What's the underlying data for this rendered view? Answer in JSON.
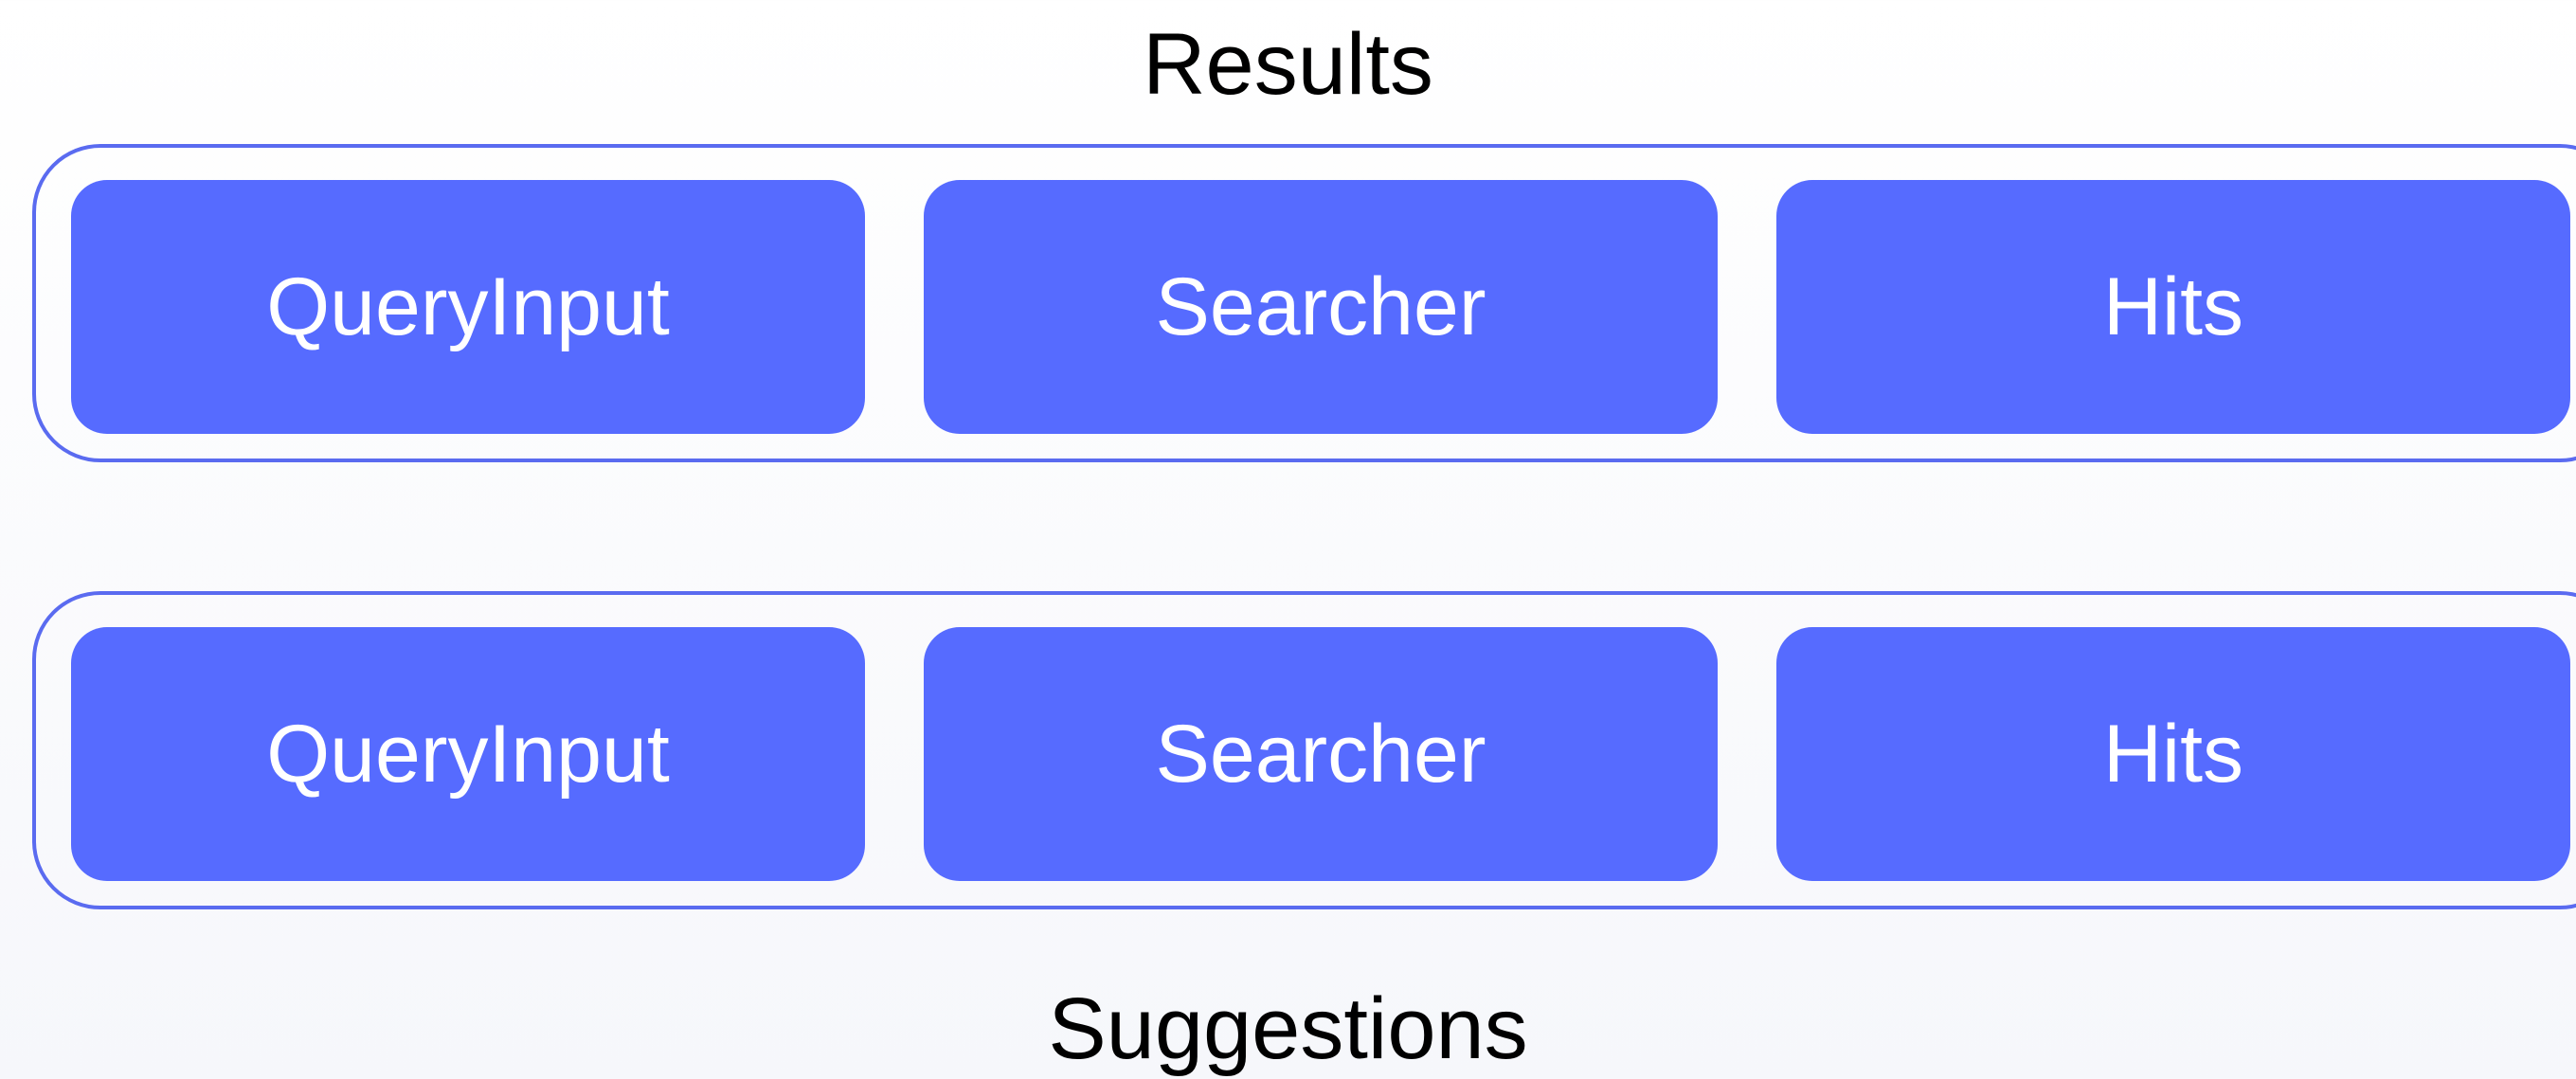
{
  "groups": [
    {
      "title": "Results",
      "components": [
        "QueryInput",
        "Searcher",
        "Hits"
      ]
    },
    {
      "title": "Suggestions",
      "components": [
        "QueryInput",
        "Searcher",
        "Hits"
      ]
    }
  ],
  "colors": {
    "box_fill": "#566bff",
    "frame_stroke": "#5a6bf0",
    "box_text": "#ffffff",
    "title_text": "#000000"
  }
}
